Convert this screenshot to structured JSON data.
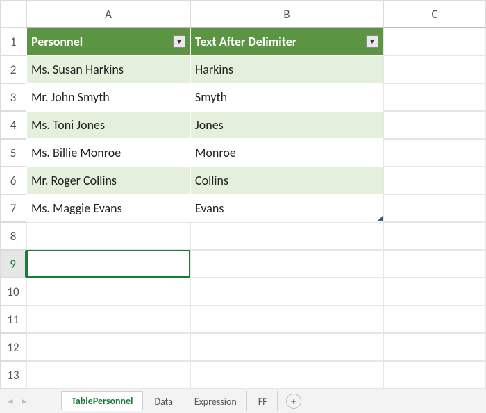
{
  "columns": [
    "A",
    "B",
    "C"
  ],
  "row_count": 13,
  "selected_row": 9,
  "table": {
    "headers": [
      "Personnel",
      "Text After Delimiter"
    ],
    "rows": [
      {
        "personnel": "Ms. Susan Harkins",
        "after": "Harkins"
      },
      {
        "personnel": "Mr. John Smyth",
        "after": "Smyth"
      },
      {
        "personnel": "Ms. Toni Jones",
        "after": "Jones"
      },
      {
        "personnel": "Ms. Billie Monroe",
        "after": "Monroe"
      },
      {
        "personnel": "Mr. Roger Collins",
        "after": "Collins"
      },
      {
        "personnel": "Ms. Maggie Evans",
        "after": "Evans"
      }
    ]
  },
  "tabs": [
    {
      "label": "TablePersonnel",
      "active": true
    },
    {
      "label": "Data",
      "active": false
    },
    {
      "label": "Expression",
      "active": false
    },
    {
      "label": "FF",
      "active": false
    }
  ],
  "icons": {
    "filter_glyph": "▼",
    "nav_left": "◄",
    "nav_right": "►",
    "plus": "+"
  }
}
